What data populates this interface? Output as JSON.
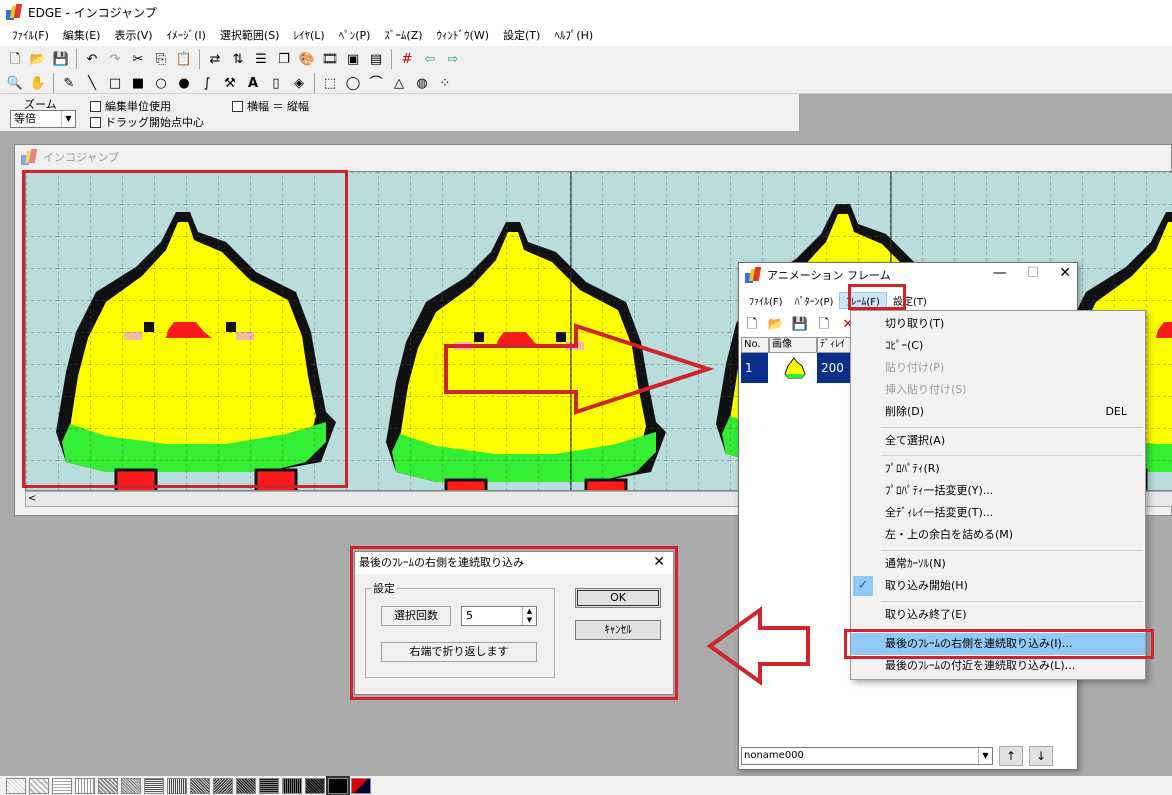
{
  "window": {
    "title": "EDGE - インコジャンプ"
  },
  "menu": [
    "ﾌｧｲﾙ(F)",
    "編集(E)",
    "表示(V)",
    "ｲﾒｰｼﾞ(I)",
    "選択範囲(S)",
    "ﾚｲﾔ(L)",
    "ﾍﾟﾝ(P)",
    "ｽﾞｰﾑ(Z)",
    "ｳｨﾝﾄﾞｳ(W)",
    "設定(T)",
    "ﾍﾙﾌﾟ(H)"
  ],
  "options": {
    "zoom_label": "ズーム",
    "zoom_value": "等倍",
    "edit_unit": "編集単位使用",
    "drag_center": "ドラッグ開始点中心",
    "keep_ratio": "横幅 ＝ 縦幅"
  },
  "doc": {
    "title": "インコジャンプ"
  },
  "anim": {
    "title": "アニメーション フレーム",
    "menu": [
      "ﾌｧｲﾙ(F)",
      "ﾊﾟﾀｰﾝ(P)",
      "ﾌﾚｰﾑ(F)",
      "設定(T)"
    ],
    "cols": [
      "No.",
      "画像",
      "ﾃﾞｨﾚｲ"
    ],
    "row": {
      "no": "1",
      "delay": "200"
    },
    "combo": "noname000",
    "up": "↑",
    "down": "↓"
  },
  "dropdown": {
    "cut": "切り取り(T)",
    "copy": "ｺﾋﾟｰ(C)",
    "paste": "貼り付け(P)",
    "insert_paste": "挿入貼り付け(S)",
    "delete": "削除(D)",
    "delete_sc": "DEL",
    "select_all": "全て選択(A)",
    "property": "ﾌﾟﾛﾊﾟﾃｨ(R)",
    "property_bulk": "ﾌﾟﾛﾊﾟﾃｨ一括変更(Y)...",
    "delay_bulk": "全ﾃﾞｨﾚｲ一括変更(T)...",
    "trim": "左・上の余白を詰める(M)",
    "normal_cursor": "通常ｶｰｿﾙ(N)",
    "capture_start": "取り込み開始(H)",
    "capture_end": "取り込み終了(E)",
    "capture_right": "最後のﾌﾚｰﾑの右側を連続取り込み(I)...",
    "capture_near": "最後のﾌﾚｰﾑの付近を連続取り込み(L)..."
  },
  "dialog": {
    "title": "最後のﾌﾚｰﾑの右側を連続取り込み",
    "group": "設定",
    "count_label": "選択回数",
    "count_value": "5",
    "wrap_note": "右端で折り返します",
    "ok": "OK",
    "cancel": "ｷｬﾝｾﾙ"
  },
  "colors": {
    "highlight_box": "#d0242a",
    "canvas": "#b9dcdc",
    "bird_yellow": "#ffff00",
    "bird_green": "#33ee33",
    "bird_red": "#ff1a1a",
    "selected_row": "#0a2f8a",
    "menu_highlight": "#91c9f7"
  },
  "icons": [
    "new-file-icon",
    "open-folder-icon",
    "save-icon",
    "undo-icon",
    "redo-icon",
    "cut-icon",
    "copy-icon",
    "paste-icon",
    "zoom-icon",
    "hand-icon",
    "pencil-icon",
    "line-icon",
    "rect-icon",
    "ellipse-icon",
    "fill-icon",
    "text-icon",
    "close-icon",
    "check-icon"
  ]
}
